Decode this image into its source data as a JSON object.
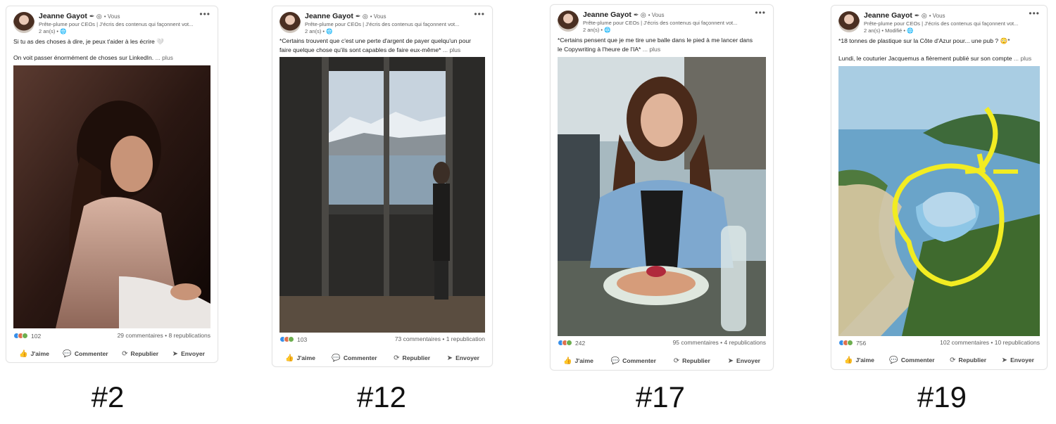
{
  "common": {
    "author": "Jeanne Gayot",
    "badges": "✒ ◎",
    "vous": "• Vous",
    "subtitle": "Prête-plume pour CEOs | J'écris des contenus qui façonnent vot...",
    "more_icon": "•••",
    "like": "J'aime",
    "comment": "Commenter",
    "repost": "Republier",
    "send": "Envoyer",
    "like_icon": "👍",
    "comment_icon": "💬",
    "repost_icon": "⟳",
    "send_icon": "➤"
  },
  "posts": [
    {
      "number": "#2",
      "meta": "2 an(s) • 🌐",
      "text1": "Si tu as des choses à dire, je peux t'aider à les écrire 🤍",
      "text2": "On voit passer énormément de choses sur LinkedIn.",
      "plus": "... plus",
      "reactions": "102",
      "stats": "29 commentaires • 8 republications"
    },
    {
      "number": "#12",
      "meta": "2 an(s) • 🌐",
      "text1": "*Certains trouvent que c'est une perte d'argent de payer quelqu'un pour",
      "text2": "faire quelque chose qu'ils sont capables de faire eux-même*",
      "plus": "... plus",
      "reactions": "103",
      "stats": "73 commentaires • 1 republication"
    },
    {
      "number": "#17",
      "meta": "2 an(s) • 🌐",
      "text1": "*Certains pensent que je me tire une balle dans le pied à me lancer dans",
      "text2": "le Copywriting à l'heure de l'IA*",
      "plus": "... plus",
      "reactions": "242",
      "stats": "95 commentaires • 4 republications"
    },
    {
      "number": "#19",
      "meta": "2 an(s) • Modifié • 🌐",
      "text1": "*18 tonnes de plastique sur la Côte d'Azur pour... une pub ? 😳*",
      "text2": "Lundi, le couturier Jacquemus a fièrement publié sur son compte",
      "plus": "... plus",
      "reactions": "756",
      "stats": "102 commentaires • 10 republications"
    }
  ]
}
